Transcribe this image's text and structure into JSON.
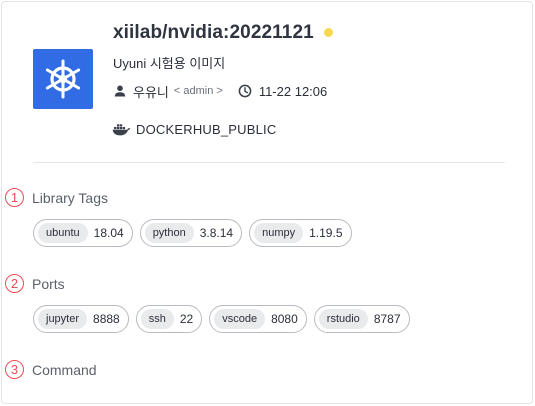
{
  "image": {
    "name": "xiilab/nvidia:20221121",
    "status_color": "#f7d84f",
    "description": "Uyuni 시험용 이미지",
    "logo_icon": "kubernetes-helm-icon",
    "logo_color": "#326ce5"
  },
  "meta": {
    "user_icon": "person-icon",
    "user_name": "우유니",
    "user_role": "< admin >",
    "clock_icon": "clock-icon",
    "timestamp": "11-22 12:06"
  },
  "registry": {
    "icon": "docker-icon",
    "name": "DOCKERHUB_PUBLIC"
  },
  "sections": {
    "library_tags": {
      "number": "1",
      "title": "Library Tags"
    },
    "ports": {
      "number": "2",
      "title": "Ports"
    },
    "command": {
      "number": "3",
      "title": "Command"
    }
  },
  "library_tags": [
    {
      "name": "ubuntu",
      "value": "18.04"
    },
    {
      "name": "python",
      "value": "3.8.14"
    },
    {
      "name": "numpy",
      "value": "1.19.5"
    }
  ],
  "ports": [
    {
      "name": "jupyter",
      "value": "8888"
    },
    {
      "name": "ssh",
      "value": "22"
    },
    {
      "name": "vscode",
      "value": "8080"
    },
    {
      "name": "rstudio",
      "value": "8787"
    }
  ]
}
